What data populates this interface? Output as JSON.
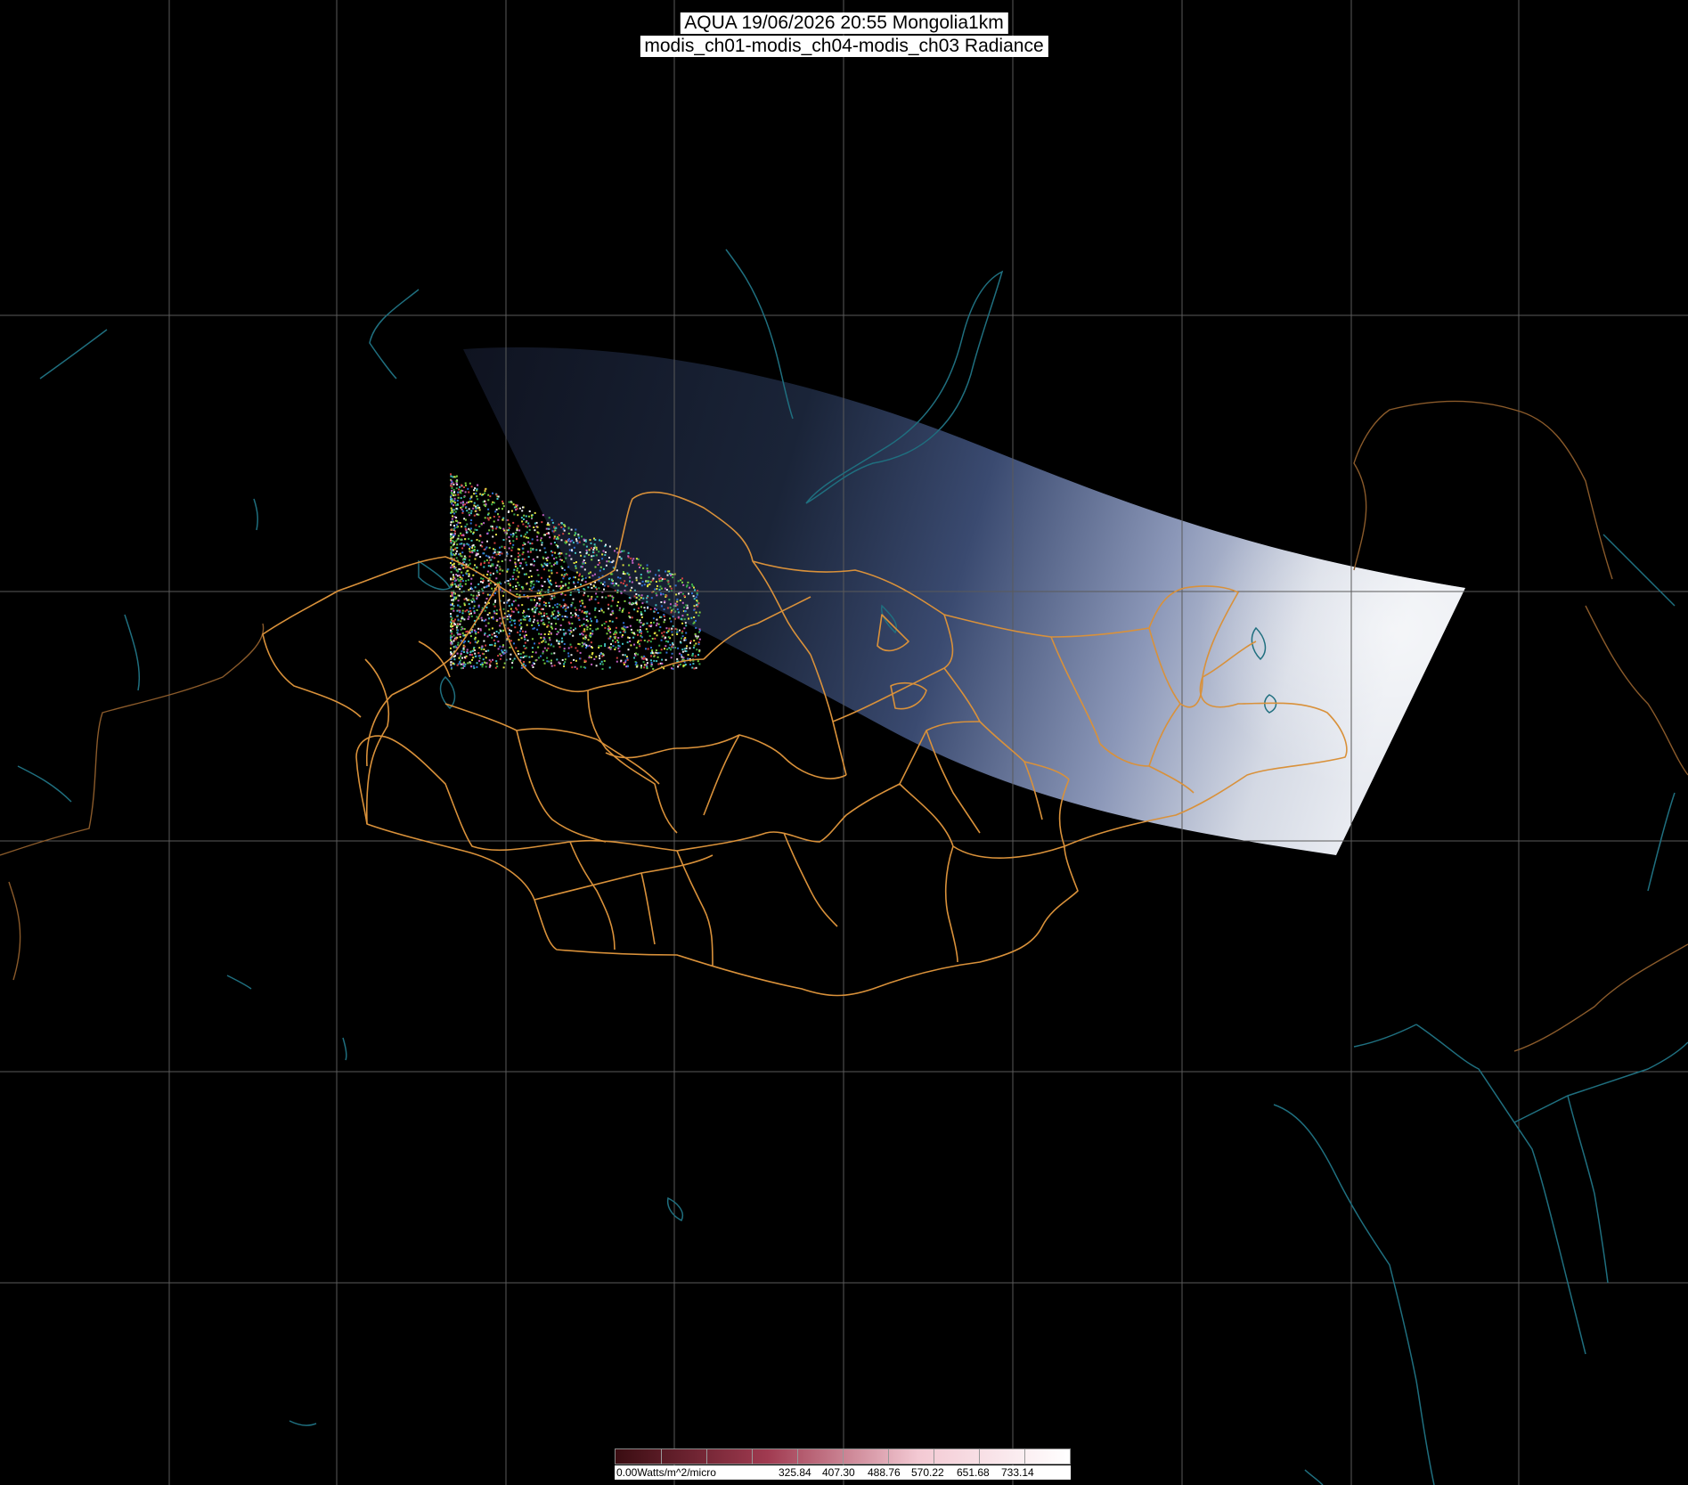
{
  "title": {
    "line1": "AQUA 19/06/2026 20:55 Mongolia1km",
    "line2": "modis_ch01-modis_ch04-modis_ch03 Radiance"
  },
  "colorbar": {
    "unit_label": "0.00Watts/m^2/micro",
    "tick_labels": [
      "325.84",
      "407.30",
      "488.76",
      "570.22",
      "651.68",
      "733.14"
    ],
    "colors": [
      "#3a0d12",
      "#a03a50",
      "#f3c9d3",
      "#ffffff"
    ]
  },
  "colors": {
    "background": "#000000",
    "graticule": "#5a5a5a",
    "coastline": "#1f6f7f",
    "admin_boundary": "#d9913a"
  }
}
